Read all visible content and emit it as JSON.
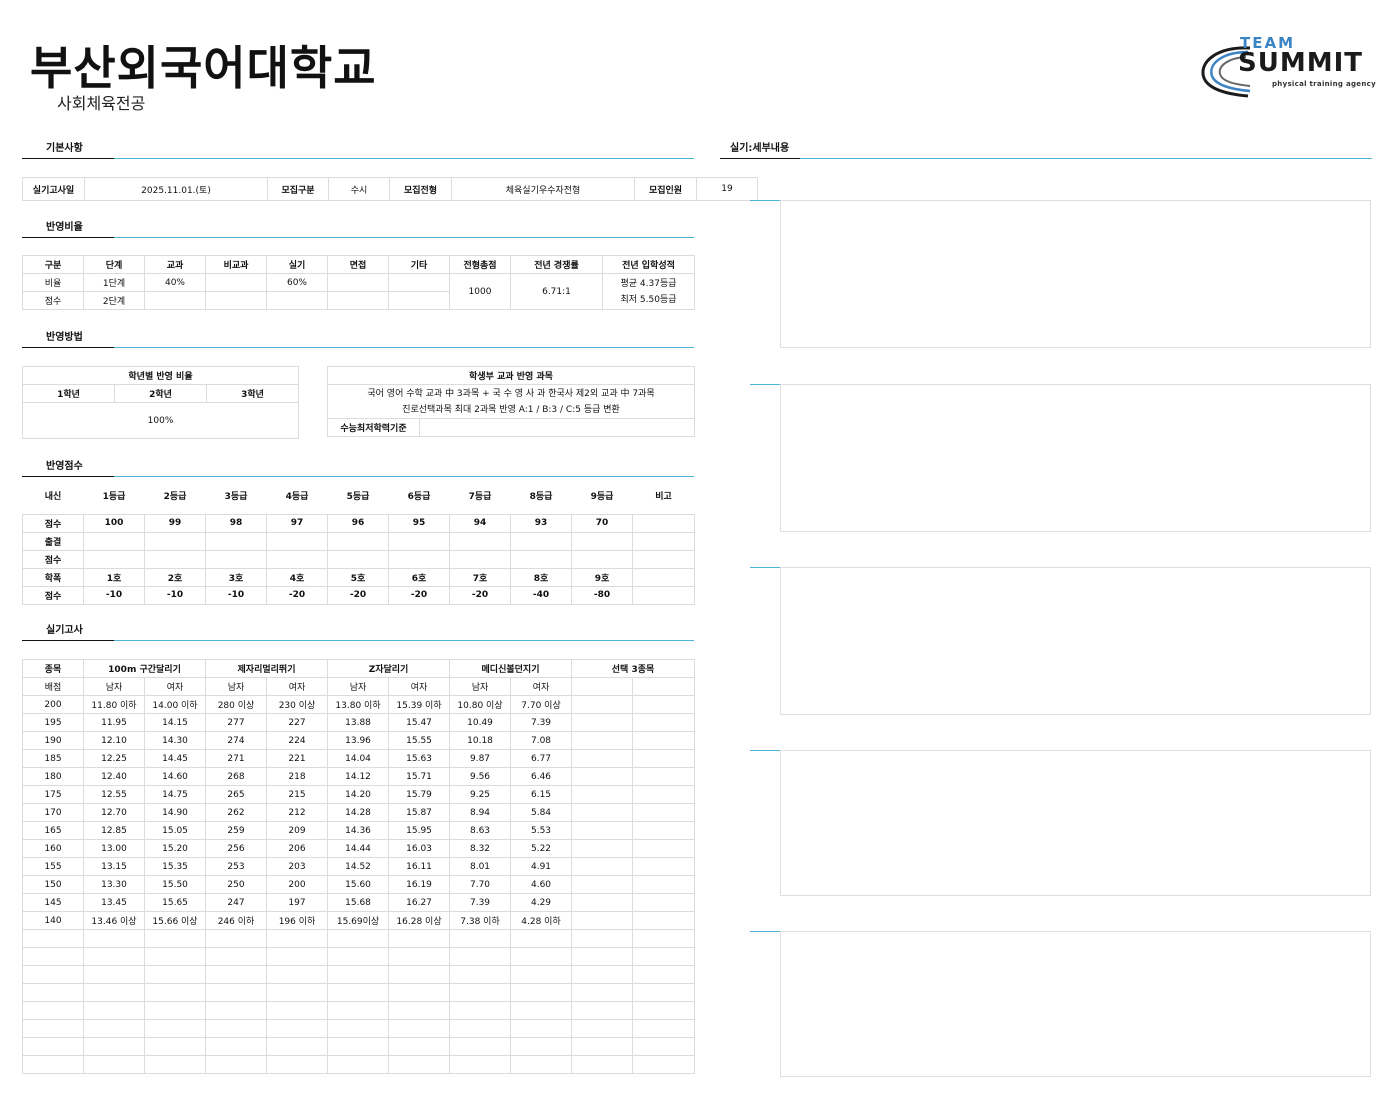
{
  "header": {
    "title": "부산외국어대학교",
    "subtitle": "사회체육전공"
  },
  "logo": {
    "team": "TEAM",
    "summit": "SUMMIT",
    "tagline": "physical training agency",
    "accent": "#3b84c4"
  },
  "sections": {
    "basic": "기본사항",
    "ratio": "반영비율",
    "method": "반영방법",
    "score": "반영점수",
    "practical": "실기고사",
    "detail": "실기:세부내용"
  },
  "basic": {
    "date_label": "실기고사일",
    "date": "2025.11.01.(토)",
    "type_label": "모집구분",
    "type": "수시",
    "track_label": "모집전형",
    "track": "체육실기우수자전형",
    "quota_label": "모집인원",
    "quota": "19"
  },
  "ratio": {
    "headers": [
      "구분",
      "단계",
      "교과",
      "비교과",
      "실기",
      "면접",
      "기타",
      "전형총점",
      "전년 경쟁률",
      "전년 입학성적"
    ],
    "row1": [
      "비율",
      "1단계",
      "40%",
      "",
      "60%",
      "",
      ""
    ],
    "row2": [
      "점수",
      "2단계",
      "",
      "",
      "",
      "",
      ""
    ],
    "total": "1000",
    "competition": "6.71:1",
    "grade_avg": "평균 4.37등급",
    "grade_min": "최저 5.50등급"
  },
  "method": {
    "year_title": "학년별 반영 비율",
    "years": [
      "1학년",
      "2학년",
      "3학년"
    ],
    "year_value": "100%",
    "subject_title": "학생부 교과 반영 과목",
    "subject_line1": "국어 영어 수학 교과 中 3과목 + 국 수 영 사 과 한국사 제2외 교과 中 7과목",
    "subject_line2": "진로선택과목 최대 2과목 반영 A:1 / B:3 / C:5 등급 변환",
    "csat_label": "수능최저학력기준",
    "csat_value": ""
  },
  "score": {
    "headers": [
      "내신",
      "1등급",
      "2등급",
      "3등급",
      "4등급",
      "5등급",
      "6등급",
      "7등급",
      "8등급",
      "9등급",
      "비고"
    ],
    "rows": [
      [
        "점수",
        "100",
        "99",
        "98",
        "97",
        "96",
        "95",
        "94",
        "93",
        "70",
        ""
      ],
      [
        "출결",
        "",
        "",
        "",
        "",
        "",
        "",
        "",
        "",
        "",
        ""
      ],
      [
        "점수",
        "",
        "",
        "",
        "",
        "",
        "",
        "",
        "",
        "",
        ""
      ],
      [
        "학폭",
        "1호",
        "2호",
        "3호",
        "4호",
        "5호",
        "6호",
        "7호",
        "8호",
        "9호",
        ""
      ],
      [
        "점수",
        "-10",
        "-10",
        "-10",
        "-20",
        "-20",
        "-20",
        "-20",
        "-40",
        "-80",
        ""
      ]
    ]
  },
  "practical": {
    "event_label": "종목",
    "events": [
      "100m 구간달리기",
      "제자리멀리뛰기",
      "Z자달리기",
      "메디신볼던지기",
      "선택 3종목"
    ],
    "point_label": "배점",
    "male": "남자",
    "female": "여자",
    "rows": [
      [
        "200",
        "11.80 이하",
        "14.00 이하",
        "280 이상",
        "230 이상",
        "13.80 이하",
        "15.39 이하",
        "10.80 이상",
        "7.70 이상"
      ],
      [
        "195",
        "11.95",
        "14.15",
        "277",
        "227",
        "13.88",
        "15.47",
        "10.49",
        "7.39"
      ],
      [
        "190",
        "12.10",
        "14.30",
        "274",
        "224",
        "13.96",
        "15.55",
        "10.18",
        "7.08"
      ],
      [
        "185",
        "12.25",
        "14.45",
        "271",
        "221",
        "14.04",
        "15.63",
        "9.87",
        "6.77"
      ],
      [
        "180",
        "12.40",
        "14.60",
        "268",
        "218",
        "14.12",
        "15.71",
        "9.56",
        "6.46"
      ],
      [
        "175",
        "12.55",
        "14.75",
        "265",
        "215",
        "14.20",
        "15.79",
        "9.25",
        "6.15"
      ],
      [
        "170",
        "12.70",
        "14.90",
        "262",
        "212",
        "14.28",
        "15.87",
        "8.94",
        "5.84"
      ],
      [
        "165",
        "12.85",
        "15.05",
        "259",
        "209",
        "14.36",
        "15.95",
        "8.63",
        "5.53"
      ],
      [
        "160",
        "13.00",
        "15.20",
        "256",
        "206",
        "14.44",
        "16.03",
        "8.32",
        "5.22"
      ],
      [
        "155",
        "13.15",
        "15.35",
        "253",
        "203",
        "14.52",
        "16.11",
        "8.01",
        "4.91"
      ],
      [
        "150",
        "13.30",
        "15.50",
        "250",
        "200",
        "15.60",
        "16.19",
        "7.70",
        "4.60"
      ],
      [
        "145",
        "13.45",
        "15.65",
        "247",
        "197",
        "15.68",
        "16.27",
        "7.39",
        "4.29"
      ],
      [
        "140",
        "13.46 이상",
        "15.66 이상",
        "246 이하",
        "196 이하",
        "15.69이상",
        "16.28 이상",
        "7.38 이하",
        "4.28 이하"
      ]
    ]
  }
}
